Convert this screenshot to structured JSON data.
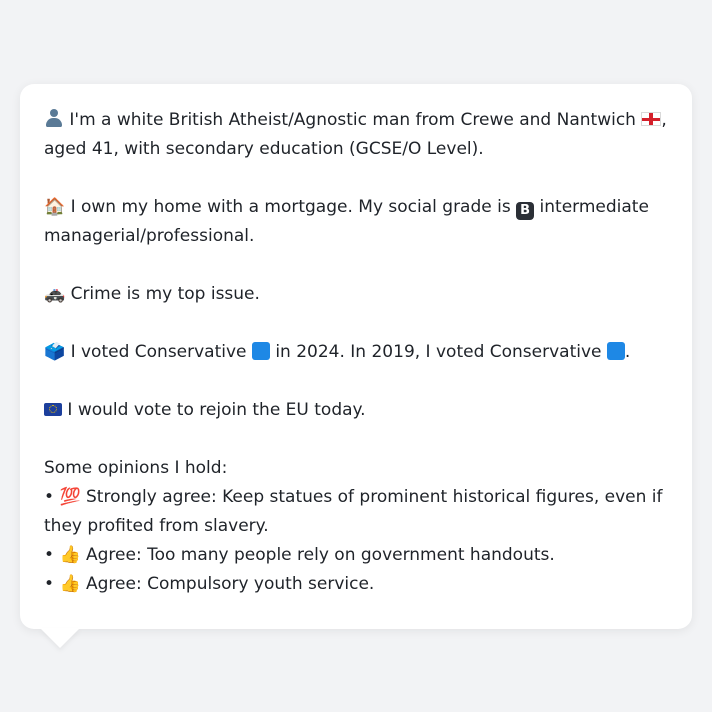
{
  "profile": {
    "identity": {
      "emoji": "👤",
      "text_1": " I'm a white British Atheist/Agnostic man from Crewe and Nantwich ",
      "flag_emoji": "🏴",
      "text_2": ", aged 41, with secondary education (GCSE/O Level)."
    },
    "home": {
      "emoji": "🏠",
      "text_1": " I own my home with a mortgage. My social grade is ",
      "grade_badge": "B",
      "text_2": " intermediate managerial/professional."
    },
    "issue": {
      "emoji": "🚓",
      "text": " Crime is my top issue."
    },
    "vote": {
      "emoji": "🗳️",
      "text_1": " I voted Conservative ",
      "text_2": " in 2024. In 2019, I voted Conservative ",
      "text_3": ".",
      "party_color": "#1e88e5"
    },
    "eu": {
      "emoji": "🇪🇺",
      "text": " I would vote to rejoin the EU today."
    },
    "opinions": {
      "heading": "Some opinions I hold:",
      "items": [
        {
          "bullet": "• ",
          "emoji": "💯",
          "text": " Strongly agree: Keep statues of prominent historical figures, even if they profited from slavery."
        },
        {
          "bullet": "• ",
          "emoji": "👍",
          "text": " Agree: Too many people rely on government handouts."
        },
        {
          "bullet": "• ",
          "emoji": "👍",
          "text": " Agree: Compulsory youth service."
        }
      ]
    }
  }
}
